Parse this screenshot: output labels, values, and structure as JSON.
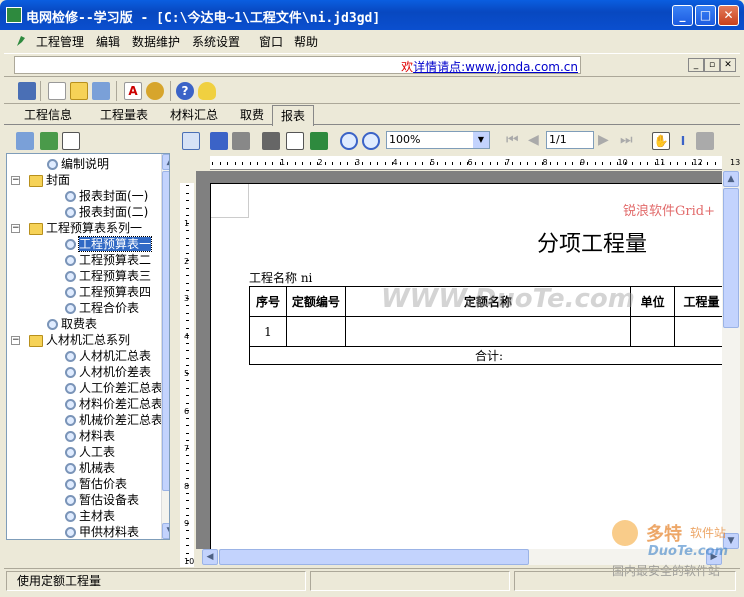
{
  "window": {
    "title": "电网检修--学习版 - [C:\\今达电~1\\工程文件\\ni.jd3gd]"
  },
  "menu": {
    "items": [
      "工程管理",
      "编辑",
      "数据维护",
      "系统设置",
      "窗口",
      "帮助"
    ]
  },
  "banner": {
    "prefix": "欢",
    "link": "详情请点:www.jonda.com.cn"
  },
  "tabs": [
    "工程信息",
    "工程量表",
    "材料汇总",
    "取费",
    "报表"
  ],
  "active_tab": "报表",
  "tree": {
    "items": [
      {
        "label": "编制说明",
        "level": 1,
        "type": "item"
      },
      {
        "label": "封面",
        "level": 0,
        "type": "folder",
        "expander": "−"
      },
      {
        "label": "报表封面(一)",
        "level": 2,
        "type": "item"
      },
      {
        "label": "报表封面(二)",
        "level": 2,
        "type": "item"
      },
      {
        "label": "工程预算表系列一",
        "level": 0,
        "type": "folder",
        "expander": "−"
      },
      {
        "label": "工程预算表一",
        "level": 2,
        "type": "item",
        "selected": true
      },
      {
        "label": "工程预算表二",
        "level": 2,
        "type": "item"
      },
      {
        "label": "工程预算表三",
        "level": 2,
        "type": "item"
      },
      {
        "label": "工程预算表四",
        "level": 2,
        "type": "item"
      },
      {
        "label": "工程合价表",
        "level": 2,
        "type": "item"
      },
      {
        "label": "取费表",
        "level": 1,
        "type": "item"
      },
      {
        "label": "人材机汇总系列",
        "level": 0,
        "type": "folder",
        "expander": "−"
      },
      {
        "label": "人材机汇总表",
        "level": 2,
        "type": "item"
      },
      {
        "label": "人材机价差表",
        "level": 2,
        "type": "item"
      },
      {
        "label": "人工价差汇总表",
        "level": 2,
        "type": "item"
      },
      {
        "label": "材料价差汇总表",
        "level": 2,
        "type": "item"
      },
      {
        "label": "机械价差汇总表",
        "level": 2,
        "type": "item"
      },
      {
        "label": "材料表",
        "level": 2,
        "type": "item"
      },
      {
        "label": "人工表",
        "level": 2,
        "type": "item"
      },
      {
        "label": "机械表",
        "level": 2,
        "type": "item"
      },
      {
        "label": "暂估价表",
        "level": 2,
        "type": "item"
      },
      {
        "label": "暂估设备表",
        "level": 2,
        "type": "item"
      },
      {
        "label": "主材表",
        "level": 2,
        "type": "item"
      },
      {
        "label": "甲供材料表",
        "level": 2,
        "type": "item"
      }
    ]
  },
  "report_toolbar": {
    "zoom": "100%",
    "page": "1/1"
  },
  "ruler": {
    "h_ticks": [
      "1",
      "2",
      "3",
      "4",
      "5",
      "6",
      "7",
      "8",
      "9",
      "10",
      "11",
      "12",
      "13"
    ],
    "v_ticks": [
      "1",
      "2",
      "3",
      "4",
      "5",
      "6",
      "7",
      "8",
      "9",
      "10"
    ]
  },
  "report": {
    "watermark": "锐浪软件Grid+",
    "title": "分项工程量",
    "project_label": "工程名称 ni",
    "headers": [
      "序号",
      "定额编号",
      "定额名称",
      "单位",
      "工程量"
    ],
    "rows": [
      [
        "1",
        "",
        "",
        "",
        ""
      ]
    ],
    "total_label": "合计:",
    "overlay": "WWW.DuoTe.com"
  },
  "status": {
    "message": "使用定额工程量"
  },
  "corner_watermark": {
    "brand": "多特",
    "brand2": "软件站",
    "site": "DuoTe.com",
    "slogan": "国内最安全的软件站"
  }
}
